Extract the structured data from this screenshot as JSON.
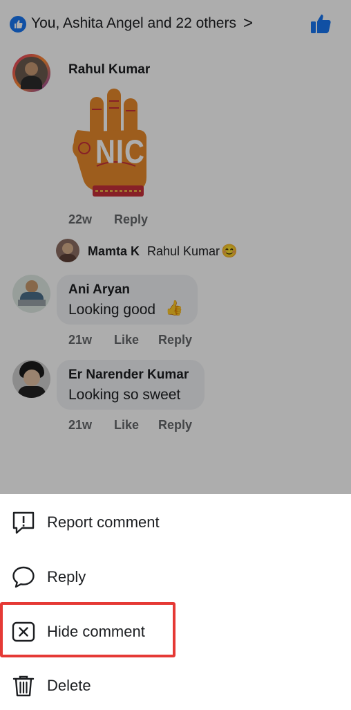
{
  "reactions": {
    "summary": "You, Ashita Angel and 22 others",
    "chevron": ">"
  },
  "comments": [
    {
      "author": "Rahul Kumar",
      "sticker_text": "NICE",
      "time": "22w",
      "reply_label": "Reply"
    },
    {
      "author": "Mamta K",
      "mention": "Rahul Kumar",
      "emoji": "😊"
    },
    {
      "author": "Ani Aryan",
      "text": "Looking good",
      "emoji": "👍",
      "time": "21w",
      "like_label": "Like",
      "reply_label": "Reply"
    },
    {
      "author": "Er Narender Kumar",
      "text": "Looking so sweet",
      "time": "21w",
      "like_label": "Like",
      "reply_label": "Reply"
    }
  ],
  "menu": {
    "items": [
      {
        "label": "Report comment",
        "icon": "report-icon"
      },
      {
        "label": "Reply",
        "icon": "chat-bubble-icon"
      },
      {
        "label": "Hide comment",
        "icon": "close-box-icon",
        "highlighted": true
      },
      {
        "label": "Delete",
        "icon": "trash-icon"
      }
    ]
  },
  "colors": {
    "fb_blue": "#1877f2",
    "highlight_red": "#e53935",
    "sticker_orange": "#e8892b",
    "sticker_red": "#c8303a"
  }
}
